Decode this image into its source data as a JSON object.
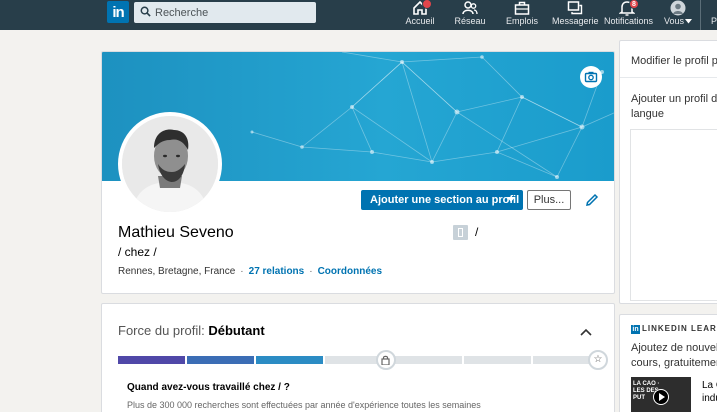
{
  "nav": {
    "logo": "in",
    "search_placeholder": "Recherche",
    "items": [
      {
        "label": "Accueil",
        "icon": "home-icon",
        "badge": ""
      },
      {
        "label": "Réseau",
        "icon": "network-icon",
        "badge": ""
      },
      {
        "label": "Emplois",
        "icon": "briefcase-icon",
        "badge": ""
      },
      {
        "label": "Messagerie",
        "icon": "messaging-icon",
        "badge": ""
      },
      {
        "label": "Notifications",
        "icon": "bell-icon",
        "badge": "8"
      },
      {
        "label": "Vous",
        "icon": "avatar-icon",
        "badge": ""
      }
    ],
    "more": "P"
  },
  "profile": {
    "name": "Mathieu Seveno",
    "headline": "/ chez /",
    "location": "Rennes, Bretagne, France",
    "connections": "27 relations",
    "contact": "Coordonnées",
    "company": "/",
    "add_section_label": "Ajouter une section au profil",
    "more_label": "Plus...",
    "banner_color": "#1f9ac9"
  },
  "strength": {
    "title_prefix": "Force du profil:",
    "level": "Débutant",
    "completed_steps": 3,
    "total_steps": 7,
    "question": "Quand avez-vous travaillé chez / ?",
    "subtext": "Plus de 300 000 recherches sont effectuées par année d'expérience toutes les semaines",
    "colors": [
      "#5048a8",
      "#3b6db5",
      "#2b8cc4",
      "#2aa3c8"
    ]
  },
  "sidebar": {
    "edit_profile": "Modifier le profil p",
    "add_profile_line1": "Ajouter un profil d",
    "add_profile_line2": "langue"
  },
  "learning": {
    "heading": "LINKEDIN LEARN",
    "promo_line1": "Ajoutez de nouvelle",
    "promo_line2": "cours, gratuitemen",
    "thumb_text": "LA CAO · LES DES · PUT",
    "course_line1": "La C",
    "course_line2": "indu"
  }
}
